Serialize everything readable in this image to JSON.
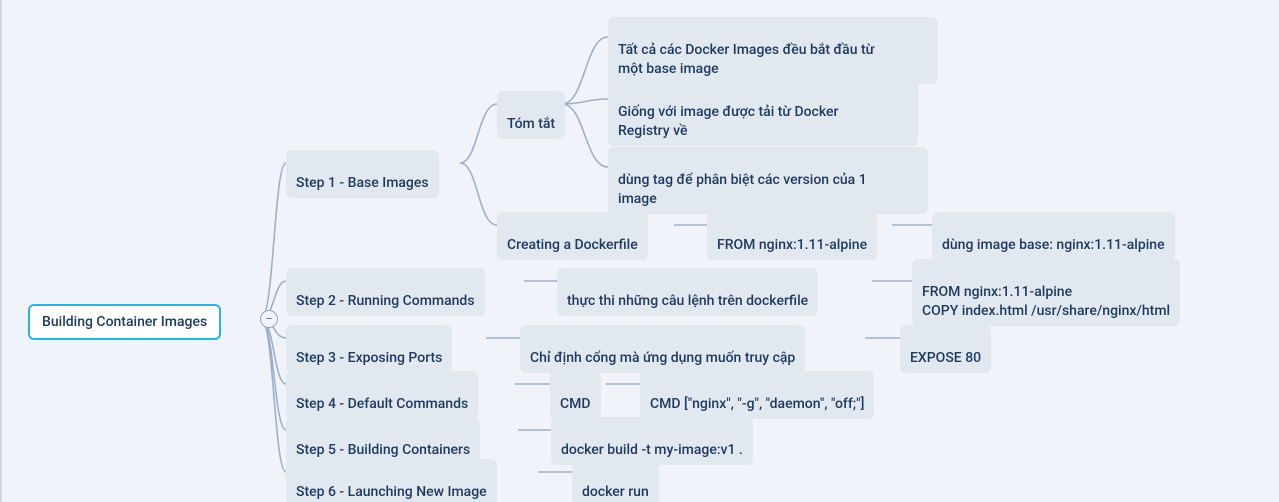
{
  "root": {
    "label": "Building Container Images"
  },
  "collapse_glyph": "−",
  "steps": {
    "s1": "Step 1 - Base Images",
    "s2": "Step 2 - Running Commands",
    "s3": "Step 3 - Exposing Ports",
    "s4": "Step 4 - Default Commands",
    "s5": "Step 5 - Building Containers",
    "s6": "Step 6 - Launching New Image"
  },
  "s1_children": {
    "summary_label": "Tóm tắt",
    "summary_items": {
      "a": "Tất cả các Docker Images đều bắt đầu từ\nmột base image",
      "b": "Giống với image được tải từ Docker\nRegistry về",
      "c": "dùng tag để phân biệt các version của 1\nimage"
    },
    "create_df": "Creating a Dockerfile",
    "from_line": "FROM nginx:1.11-alpine",
    "from_note": "dùng image base: nginx:1.11-alpine"
  },
  "s2_children": {
    "desc": "thực thi những câu lệnh trên dockerfile",
    "code": "FROM nginx:1.11-alpine\nCOPY index.html /usr/share/nginx/html"
  },
  "s3_children": {
    "desc": "Chỉ định cổng mà ứng dụng muốn truy cập",
    "code": "EXPOSE 80"
  },
  "s4_children": {
    "cmd": "CMD",
    "example": "CMD [\"nginx\", \"-g\", \"daemon\", \"off;\"]"
  },
  "s5_children": {
    "cmd": "docker build -t my-image:v1 ."
  },
  "s6_children": {
    "cmd": "docker run"
  }
}
